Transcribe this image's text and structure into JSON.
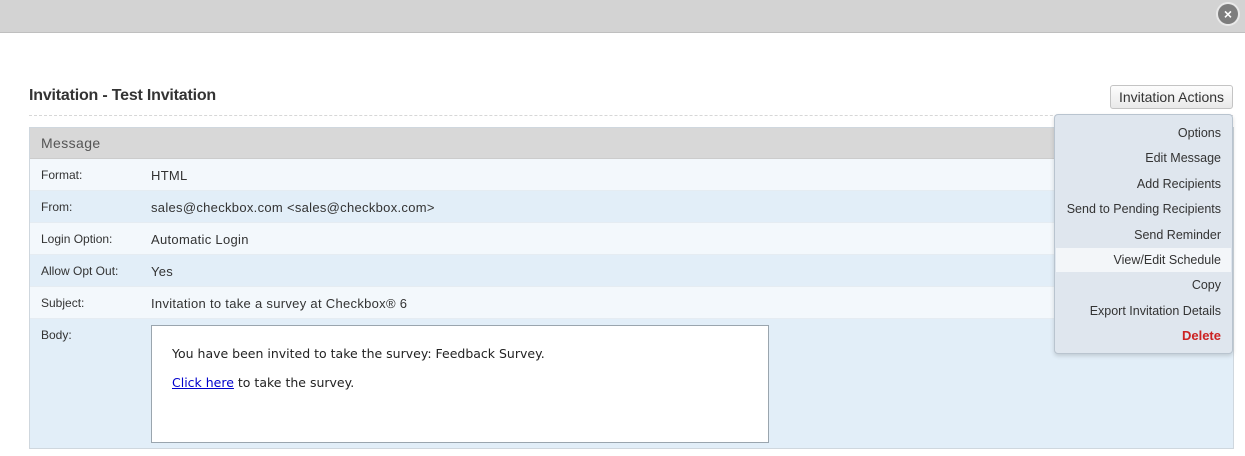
{
  "window": {
    "close_symbol": "×"
  },
  "page": {
    "title": "Invitation - Test Invitation"
  },
  "actions": {
    "button_label": "Invitation Actions",
    "menu": [
      {
        "label": "Options"
      },
      {
        "label": "Edit Message"
      },
      {
        "label": "Add Recipients"
      },
      {
        "label": "Send to Pending Recipients"
      },
      {
        "label": "Send Reminder"
      },
      {
        "label": "View/Edit Schedule",
        "highlighted": true
      },
      {
        "label": "Copy"
      },
      {
        "label": "Export Invitation Details"
      },
      {
        "label": "Delete",
        "danger": true
      }
    ]
  },
  "message": {
    "header": "Message",
    "rows": [
      {
        "label": "Format:",
        "value": "HTML"
      },
      {
        "label": "From:",
        "value": "sales@checkbox.com <sales@checkbox.com>"
      },
      {
        "label": "Login Option:",
        "value": "Automatic Login"
      },
      {
        "label": "Allow Opt Out:",
        "value": "Yes"
      },
      {
        "label": "Subject:",
        "value": "Invitation to take a survey at Checkbox® 6"
      }
    ],
    "body_label": "Body:",
    "body": {
      "line1": "You have been invited to take the survey: Feedback Survey.",
      "link_text": "Click here",
      "line2_rest": " to take the survey."
    }
  },
  "colors": {
    "panel_bg": "#e2eef8",
    "delete": "#cc2222",
    "link": "#0000cc"
  }
}
